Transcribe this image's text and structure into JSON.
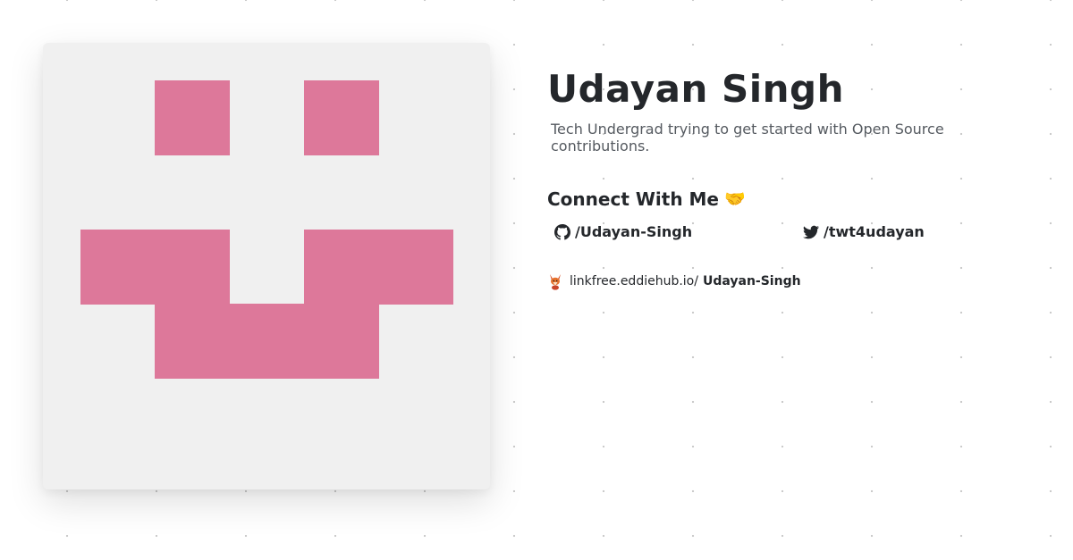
{
  "profile": {
    "name": "Udayan Singh",
    "bio": "Tech Undergrad trying to get started with Open Source contributions."
  },
  "connect": {
    "heading": "Connect With Me",
    "emoji": "🤝",
    "links": [
      {
        "platform": "github",
        "icon": "github-icon",
        "label": "/Udayan-Singh"
      },
      {
        "platform": "twitter",
        "icon": "twitter-icon",
        "label": "/twt4udayan"
      }
    ]
  },
  "footer": {
    "icon": "linkfree-fox-icon",
    "domain": "linkfree.eddiehub.io/",
    "username": "Udayan-Singh"
  },
  "avatar": {
    "icon": "identicon-avatar",
    "background": "#f0f0f0",
    "color": "#dd789a"
  }
}
